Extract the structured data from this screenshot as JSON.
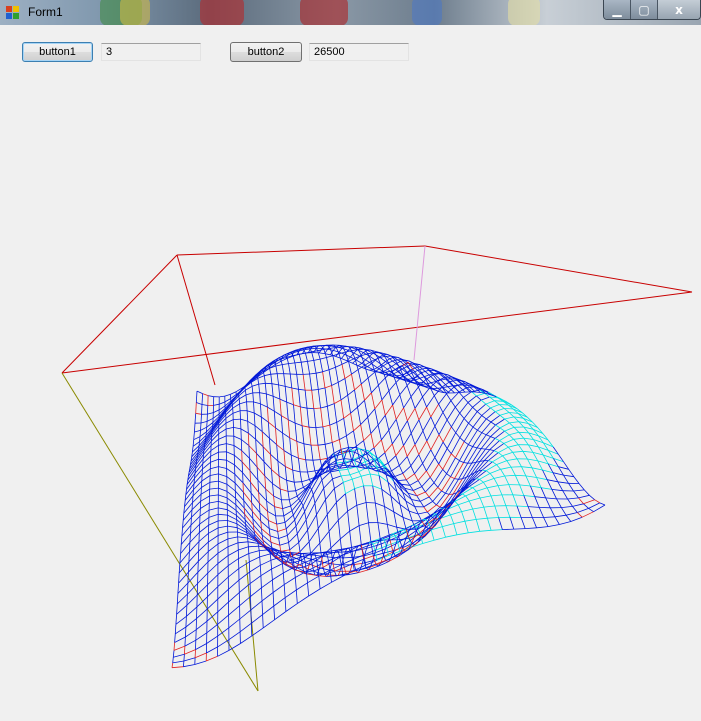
{
  "window": {
    "title": "Form1"
  },
  "controls": {
    "button1_label": "button1",
    "field1_value": "3",
    "button2_label": "button2",
    "field2_value": "26500"
  },
  "window_buttons": {
    "minimize": "▁",
    "maximize": "▢",
    "close": "x"
  },
  "colors": {
    "box_red": "#c80000",
    "box_olive": "#8a8a00",
    "box_pink": "#dd99dd",
    "mesh_blue": "#0018d8",
    "mesh_red": "#e02020",
    "mesh_cyan": "#00e0e0"
  },
  "surface": {
    "description_icon": "3d-wireframe-surface",
    "grid_resolution": 38
  }
}
